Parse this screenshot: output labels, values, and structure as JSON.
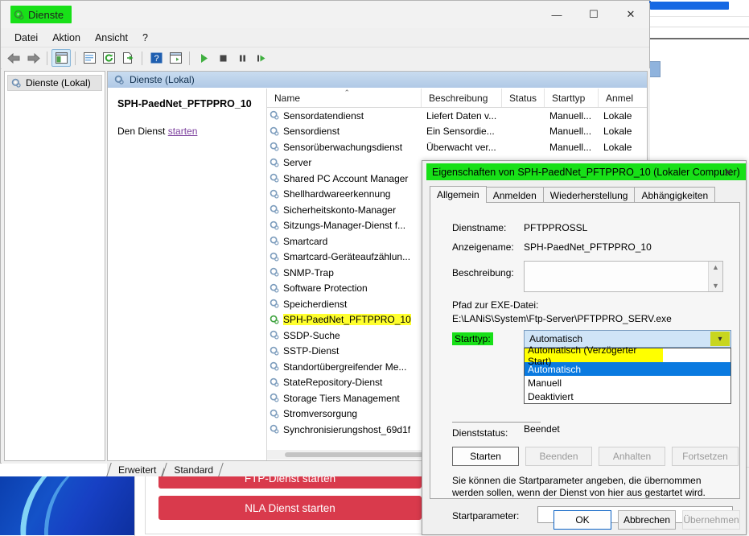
{
  "mmc": {
    "title": "Dienste",
    "title_icon": "gear-services-icon",
    "menu": [
      "Datei",
      "Aktion",
      "Ansicht",
      "?"
    ],
    "window_buttons": {
      "minimize": "—",
      "maximize": "☐",
      "close": "✕"
    },
    "toolbar_icons": [
      "back-arrow-icon",
      "forward-arrow-icon",
      "show-tree-icon",
      "properties-icon",
      "refresh-icon",
      "export-list-icon",
      "help-icon",
      "new-window-icon",
      "start-service-icon",
      "stop-service-icon",
      "pause-service-icon",
      "restart-service-icon"
    ],
    "tree": {
      "root_label": "Dienste (Lokal)",
      "root_icon": "gear-services-icon"
    },
    "detail_header": {
      "label": "Dienste (Lokal)",
      "icon": "gear-services-icon"
    },
    "info_panel": {
      "service_title": "SPH-PaedNet_PFTPPRO_10",
      "action_prefix": "Den Dienst ",
      "action_link": "starten"
    },
    "columns": [
      {
        "key": "name",
        "label": "Name",
        "sorted": true,
        "sort_mark": "⌃"
      },
      {
        "key": "desc",
        "label": "Beschreibung"
      },
      {
        "key": "status",
        "label": "Status"
      },
      {
        "key": "start",
        "label": "Starttyp"
      },
      {
        "key": "anmel",
        "label": "Anmel"
      }
    ],
    "rows": [
      {
        "name": "Sensordatendienst",
        "desc": "Liefert Daten v...",
        "status": "",
        "start": "Manuell...",
        "anmel": "Lokale",
        "selected": false
      },
      {
        "name": "Sensordienst",
        "desc": "Ein Sensordie...",
        "status": "",
        "start": "Manuell...",
        "anmel": "Lokale",
        "selected": false
      },
      {
        "name": "Sensorüberwachungsdienst",
        "desc": "Überwacht ver...",
        "status": "",
        "start": "Manuell...",
        "anmel": "Lokale",
        "selected": false
      },
      {
        "name": "Server",
        "desc": "",
        "status": "",
        "start": "",
        "anmel": "",
        "selected": false
      },
      {
        "name": "Shared PC Account Manager",
        "desc": "",
        "status": "",
        "start": "",
        "anmel": "",
        "selected": false
      },
      {
        "name": "Shellhardwareerkennung",
        "desc": "",
        "status": "",
        "start": "",
        "anmel": "",
        "selected": false
      },
      {
        "name": "Sicherheitskonto-Manager",
        "desc": "",
        "status": "",
        "start": "",
        "anmel": "",
        "selected": false
      },
      {
        "name": "Sitzungs-Manager-Dienst f...",
        "desc": "",
        "status": "",
        "start": "",
        "anmel": "",
        "selected": false
      },
      {
        "name": "Smartcard",
        "desc": "",
        "status": "",
        "start": "",
        "anmel": "",
        "selected": false
      },
      {
        "name": "Smartcard-Geräteaufzählun...",
        "desc": "",
        "status": "",
        "start": "",
        "anmel": "",
        "selected": false
      },
      {
        "name": "SNMP-Trap",
        "desc": "",
        "status": "",
        "start": "",
        "anmel": "",
        "selected": false
      },
      {
        "name": "Software Protection",
        "desc": "",
        "status": "",
        "start": "",
        "anmel": "",
        "selected": false
      },
      {
        "name": "Speicherdienst",
        "desc": "",
        "status": "",
        "start": "",
        "anmel": "",
        "selected": false
      },
      {
        "name": "SPH-PaedNet_PFTPPRO_10",
        "desc": "",
        "status": "",
        "start": "",
        "anmel": "",
        "selected": true
      },
      {
        "name": "SSDP-Suche",
        "desc": "",
        "status": "",
        "start": "",
        "anmel": "",
        "selected": false
      },
      {
        "name": "SSTP-Dienst",
        "desc": "",
        "status": "",
        "start": "",
        "anmel": "",
        "selected": false
      },
      {
        "name": "Standortübergreifender Me...",
        "desc": "",
        "status": "",
        "start": "",
        "anmel": "",
        "selected": false
      },
      {
        "name": "StateRepository-Dienst",
        "desc": "",
        "status": "",
        "start": "",
        "anmel": "",
        "selected": false
      },
      {
        "name": "Storage Tiers Management",
        "desc": "",
        "status": "",
        "start": "",
        "anmel": "",
        "selected": false
      },
      {
        "name": "Stromversorgung",
        "desc": "",
        "status": "",
        "start": "",
        "anmel": "",
        "selected": false
      },
      {
        "name": "Synchronisierungshost_69d1f",
        "desc": "",
        "status": "",
        "start": "",
        "anmel": "",
        "selected": false
      }
    ],
    "bottom_tabs": [
      {
        "label": "Erweitert",
        "active": false
      },
      {
        "label": "Standard",
        "active": true
      }
    ]
  },
  "properties": {
    "title": "Eigenschaften von SPH-PaedNet_PFTPPRO_10 (Lokaler Computer)",
    "close_glyph": "✕",
    "tabs": [
      {
        "label": "Allgemein",
        "active": true
      },
      {
        "label": "Anmelden",
        "active": false
      },
      {
        "label": "Wiederherstellung",
        "active": false
      },
      {
        "label": "Abhängigkeiten",
        "active": false
      }
    ],
    "fields": {
      "service_name_label": "Dienstname:",
      "service_name_value": "PFTPPROSSL",
      "display_name_label": "Anzeigename:",
      "display_name_value": "SPH-PaedNet_PFTPPRO_10",
      "description_label": "Beschreibung:",
      "description_value": "",
      "exe_path_label": "Pfad zur EXE-Datei:",
      "exe_path_value": "E:\\LANiS\\System\\Ftp-Server\\PFTPPRO_SERV.exe",
      "starttype_label": "Starttyp:",
      "starttype_value": "Automatisch",
      "service_status_label": "Dienststatus:",
      "service_status_value": "Beendet",
      "start_params_label": "Startparameter:",
      "start_params_value": ""
    },
    "dropdown": {
      "open": true,
      "options": [
        {
          "label": "Automatisch (Verzögerter Start)",
          "highlight": "yellow"
        },
        {
          "label": "Automatisch",
          "highlight": "blue"
        },
        {
          "label": "Manuell",
          "highlight": "none"
        },
        {
          "label": "Deaktiviert",
          "highlight": "none"
        }
      ]
    },
    "service_buttons": [
      {
        "label": "Starten",
        "enabled": true
      },
      {
        "label": "Beenden",
        "enabled": false
      },
      {
        "label": "Anhalten",
        "enabled": false
      },
      {
        "label": "Fortsetzen",
        "enabled": false
      }
    ],
    "hint_text": "Sie können die Startparameter angeben, die übernommen werden sollen, wenn der Dienst von hier aus gestartet wird.",
    "dialog_buttons": [
      {
        "label": "OK",
        "style": "default",
        "enabled": true
      },
      {
        "label": "Abbrechen",
        "style": "normal",
        "enabled": true
      },
      {
        "label": "Übernehmen",
        "style": "disabled",
        "enabled": false
      }
    ]
  },
  "background": {
    "red_buttons": [
      {
        "label": "FTP-Dienst starten"
      },
      {
        "label": "NLA Dienst starten"
      }
    ]
  },
  "colors": {
    "highlight_green": "#18e018",
    "highlight_yellow": "#ffff2e",
    "dropdown_yellow": "#ffff00",
    "selection_blue": "#0a7ae0",
    "combo_fill": "#cfe4f7",
    "combo_arrow": "#c8d620",
    "red_button": "#d93a4c",
    "link_purple": "#7b3f9d",
    "accent_blue": "#2b68c6"
  }
}
